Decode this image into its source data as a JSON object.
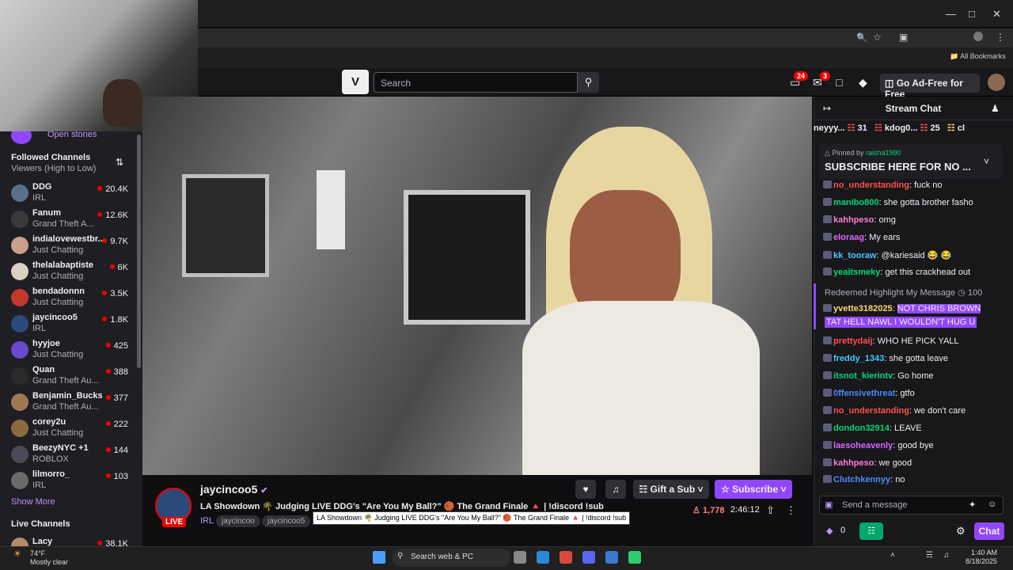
{
  "browser": {
    "bookmarks_label": "All Bookmarks",
    "window_controls": [
      "minimize-icon",
      "restore-icon",
      "close-icon"
    ]
  },
  "topnav": {
    "logo_text": "V",
    "search_placeholder": "Search",
    "notifications_count": "24",
    "inbox_count": "3",
    "adfree_label": "Go Ad-Free for Free"
  },
  "sidebar": {
    "open_stories": "Open stories",
    "followed_title": "Followed Channels",
    "sort_label": "Viewers (High to Low)",
    "channels": [
      {
        "name": "DDG",
        "game": "IRL",
        "viewers": "20.4K",
        "color": "#5a6f8a"
      },
      {
        "name": "Fanum",
        "game": "Grand Theft A...",
        "viewers": "12.6K",
        "color": "#3a3a3a"
      },
      {
        "name": "indialovewestbr...",
        "game": "Just Chatting",
        "viewers": "9.7K",
        "color": "#c9a08a"
      },
      {
        "name": "thelalabaptiste",
        "game": "Just Chatting",
        "viewers": "6K",
        "color": "#d8d0c0"
      },
      {
        "name": "bendadonnn",
        "game": "Just Chatting",
        "viewers": "3.5K",
        "color": "#c0392b"
      },
      {
        "name": "jaycincoo5",
        "game": "IRL",
        "viewers": "1.8K",
        "color": "#2a4a7a"
      },
      {
        "name": "hyyjoe",
        "game": "Just Chatting",
        "viewers": "425",
        "color": "#6a4ad0"
      },
      {
        "name": "Quan",
        "game": "Grand Theft Au...",
        "viewers": "388",
        "color": "#2a2a2a"
      },
      {
        "name": "Benjamin_Bucks",
        "game": "Grand Theft Au...",
        "viewers": "377",
        "color": "#a07850"
      },
      {
        "name": "corey2u",
        "game": "Just Chatting",
        "viewers": "222",
        "color": "#8a6a40"
      },
      {
        "name": "BeezyNYC +1",
        "game": "ROBLOX",
        "viewers": "144",
        "color": "#4a4a5a"
      },
      {
        "name": "lilmorro_",
        "game": "IRL",
        "viewers": "103",
        "color": "#6a6a6a"
      }
    ],
    "show_more": "Show More",
    "live_title": "Live Channels",
    "live_first": {
      "name": "Lacy",
      "viewers": "38.1K"
    }
  },
  "stream": {
    "streamer": "jaycincoo5",
    "live_badge": "LIVE",
    "title": "LA Showdown 🌴 Judging LIVE DDG's \"Are You My Ball?\" 🏀 The Grand Finale 🔺 | !discord !sub",
    "category": "IRL",
    "tags": [
      "jaycincoo",
      "jaycincoo5"
    ],
    "tooltip": "LA Showdown 🌴 Judging LIVE DDG's \"Are You My Ball?\" 🏀 The Grand Finale 🔺 | !discord !sub",
    "gift_label": "Gift a Sub",
    "subscribe_label": "Subscribe",
    "viewers": "1,778",
    "uptime": "2:46:12"
  },
  "chat": {
    "header": "Stream Chat",
    "gift_leaders": [
      {
        "name": "neyyy...",
        "count": "31"
      },
      {
        "name": "kdog0...",
        "count": "25"
      },
      {
        "name": "cl",
        "count": ""
      }
    ],
    "pinned_by": "Pinned by",
    "pinned_user": "raisha1990",
    "pinned_text": "SUBSCRIBE HERE FOR NO ...",
    "redeemed_label": "Redeemed Highlight My Message",
    "redeemed_cost": "100",
    "messages": [
      {
        "user": "no_understanding",
        "text": ": fuck no",
        "color": "#ff4f4f"
      },
      {
        "user": "manibo800",
        "text": ": she gotta brother fasho",
        "color": "#00d977"
      },
      {
        "user": "kahhpeso",
        "text": ": omg",
        "color": "#ff7ad9"
      },
      {
        "user": "eloraag",
        "text": ": My ears",
        "color": "#d966ff"
      },
      {
        "user": "kk_tooraw",
        "text": ": @kariesaid 😂 😂",
        "color": "#4ac6ff"
      },
      {
        "user": "yeaitsmeky",
        "text": ": get this crackhead out",
        "color": "#00d977"
      },
      {
        "user": "yvette3182025",
        "text": ": ",
        "color": "#ffd36b",
        "highlight": "NOT CHRIS BROWN"
      },
      {
        "user": "prettydaij",
        "text": ": WHO HE PICK YALL",
        "color": "#ff4f4f"
      },
      {
        "user": "freddy_1343",
        "text": ": she gotta leave",
        "color": "#4ac6ff"
      },
      {
        "user": "itsnot_kierintv",
        "text": ": Go home",
        "color": "#00d977"
      },
      {
        "user": "0ffensivethreat",
        "text": ": gtfo",
        "color": "#4a8aff"
      },
      {
        "user": "no_understanding",
        "text": ": we don't care",
        "color": "#ff4f4f"
      },
      {
        "user": "dondon32914",
        "text": ": LEAVE",
        "color": "#00d977"
      },
      {
        "user": "laesoheavenly",
        "text": ": good bye",
        "color": "#d966ff"
      },
      {
        "user": "kahhpeso",
        "text": ": we good",
        "color": "#ff7ad9"
      },
      {
        "user": "Clutchkennyy",
        "text": ": no",
        "color": "#4a8aff"
      }
    ],
    "highlight_line2": "TAT HELL NAWL I WOULDN'T HUG U",
    "input_placeholder": "Send a message",
    "points": "0",
    "chat_button": "Chat"
  },
  "taskbar": {
    "weather_temp": "74°F",
    "weather_desc": "Mostly clear",
    "search_placeholder": "Search web & PC",
    "time": "1:40 AM",
    "date": "8/18/2025"
  }
}
